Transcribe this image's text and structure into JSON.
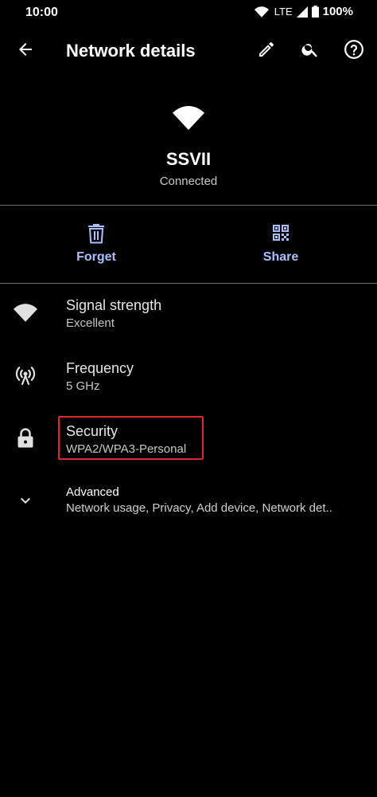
{
  "status_bar": {
    "time": "10:00",
    "network": "LTE",
    "battery": "100%"
  },
  "app_bar": {
    "title": "Network details",
    "back_icon": "arrow-back-icon",
    "edit_icon": "edit-pencil-icon",
    "search_icon": "search-icon",
    "help_icon": "help-circle-icon"
  },
  "hero": {
    "icon": "wifi-icon",
    "network_name": "SSVII",
    "status": "Connected"
  },
  "actions": [
    {
      "label": "Forget",
      "icon": "trash-icon"
    },
    {
      "label": "Share",
      "icon": "qr-code-icon"
    }
  ],
  "details": [
    {
      "title": "Signal strength",
      "value": "Excellent",
      "icon": "wifi-icon"
    },
    {
      "title": "Frequency",
      "value": "5 GHz",
      "icon": "antenna-icon"
    },
    {
      "title": "Security",
      "value": "WPA2/WPA3-Personal",
      "icon": "lock-icon"
    }
  ],
  "advanced": {
    "title": "Advanced",
    "summary": "Network usage, Privacy, Add device, Network det..",
    "icon": "chevron-down-icon"
  },
  "colors": {
    "background": "#000000",
    "accent": "#a8c0ff",
    "highlight": "#e3252a",
    "divider": "#6e6e6e"
  }
}
